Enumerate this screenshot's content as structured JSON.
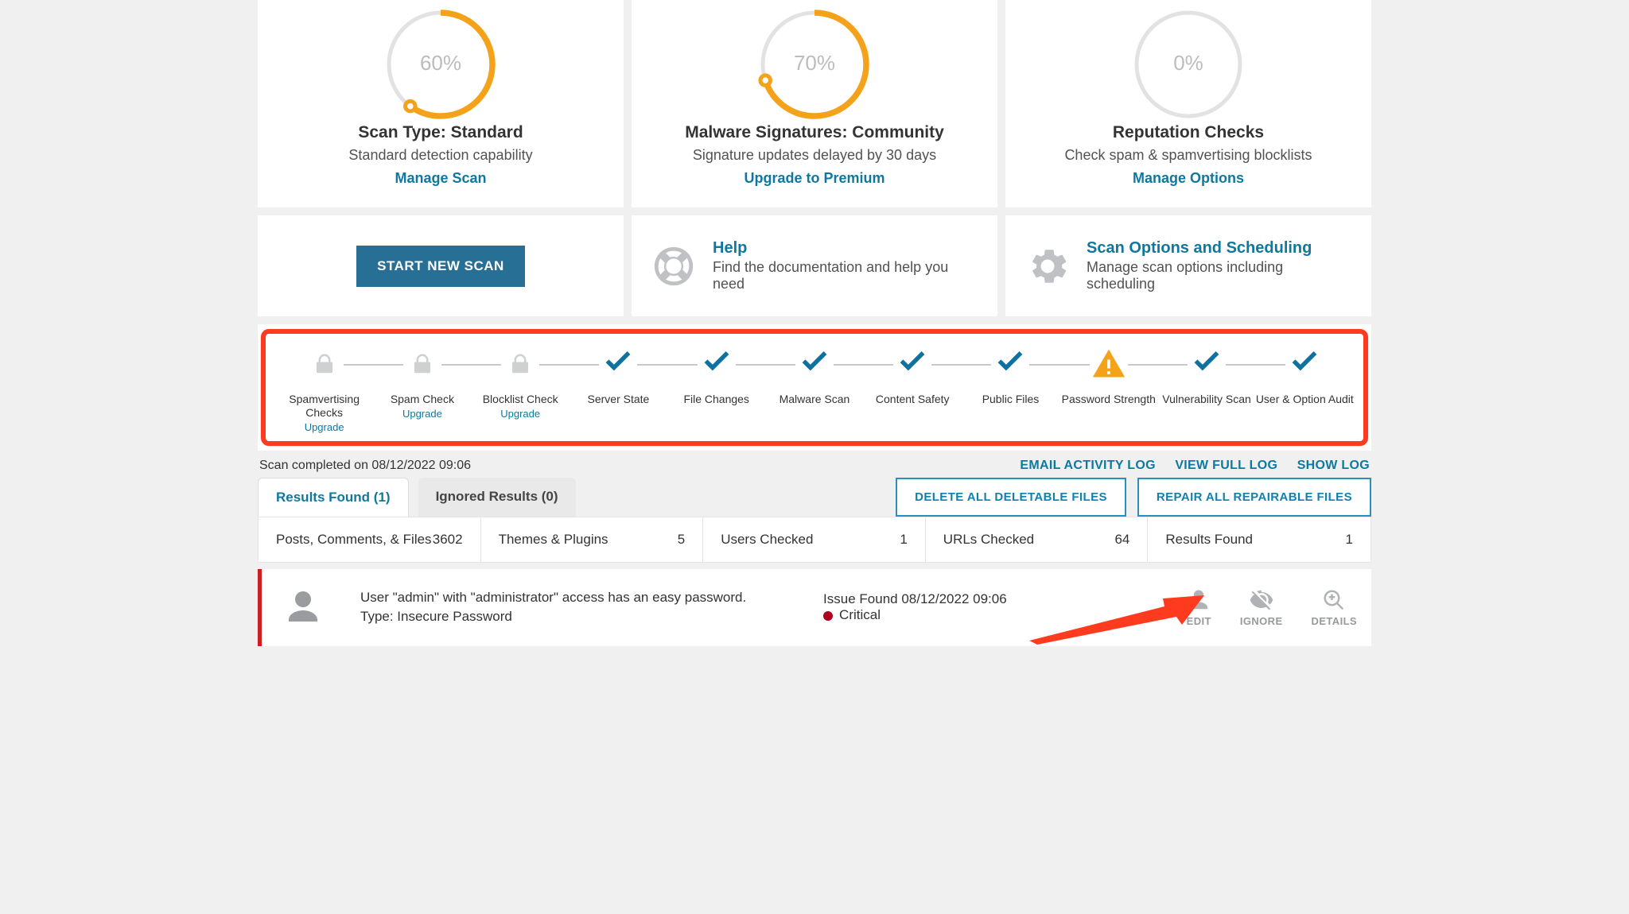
{
  "scores": [
    {
      "percent": 60,
      "title": "Scan Type: Standard",
      "subtitle": "Standard detection capability",
      "link": "Manage Scan"
    },
    {
      "percent": 70,
      "title": "Malware Signatures: Community",
      "subtitle": "Signature updates delayed by 30 days",
      "link": "Upgrade to Premium"
    },
    {
      "percent": 0,
      "title": "Reputation Checks",
      "subtitle": "Check spam & spamvertising blocklists",
      "link": "Manage Options"
    }
  ],
  "action": {
    "scan_button": "START NEW SCAN",
    "help_title": "Help",
    "help_text": "Find the documentation and help you need",
    "opts_title": "Scan Options and Scheduling",
    "opts_text": "Manage scan options including scheduling"
  },
  "steps": [
    {
      "label": "Spamvertising Checks",
      "icon": "lock",
      "upgrade": "Upgrade"
    },
    {
      "label": "Spam Check",
      "icon": "lock",
      "upgrade": "Upgrade"
    },
    {
      "label": "Blocklist Check",
      "icon": "lock",
      "upgrade": "Upgrade"
    },
    {
      "label": "Server State",
      "icon": "check"
    },
    {
      "label": "File Changes",
      "icon": "check"
    },
    {
      "label": "Malware Scan",
      "icon": "check"
    },
    {
      "label": "Content Safety",
      "icon": "check"
    },
    {
      "label": "Public Files",
      "icon": "check"
    },
    {
      "label": "Password Strength",
      "icon": "warn"
    },
    {
      "label": "Vulnerability Scan",
      "icon": "check"
    },
    {
      "label": "User & Option Audit",
      "icon": "check"
    }
  ],
  "scan_completed": "Scan completed on 08/12/2022 09:06",
  "log_links": {
    "email": "EMAIL ACTIVITY LOG",
    "full": "VIEW FULL LOG",
    "show": "SHOW LOG"
  },
  "tabs": {
    "results": "Results Found (1)",
    "ignored": "Ignored Results (0)"
  },
  "bulk": {
    "delete": "DELETE ALL DELETABLE FILES",
    "repair": "REPAIR ALL REPAIRABLE FILES"
  },
  "stats": [
    {
      "label": "Posts, Comments, & Files",
      "value": "3602"
    },
    {
      "label": "Themes & Plugins",
      "value": "5"
    },
    {
      "label": "Users Checked",
      "value": "1"
    },
    {
      "label": "URLs Checked",
      "value": "64"
    },
    {
      "label": "Results Found",
      "value": "1"
    }
  ],
  "issue": {
    "line1": "User \"admin\" with \"administrator\" access has an easy password.",
    "line2": "Type: Insecure Password",
    "found_line": "Issue Found 08/12/2022 09:06",
    "severity": "Critical",
    "actions": {
      "edit": "EDIT",
      "ignore": "IGNORE",
      "details": "DETAILS"
    }
  }
}
